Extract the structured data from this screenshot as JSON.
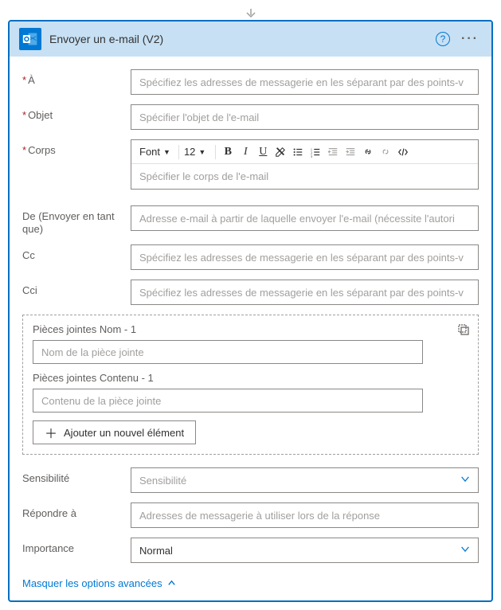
{
  "header": {
    "title": "Envoyer un e-mail (V2)"
  },
  "fields": {
    "to": {
      "label": "À",
      "placeholder": "Spécifiez les adresses de messagerie en les séparant par des points-v"
    },
    "subject": {
      "label": "Objet",
      "placeholder": "Spécifier l'objet de l'e-mail"
    },
    "body": {
      "label": "Corps",
      "placeholder": "Spécifier le corps de l'e-mail",
      "font": "Font",
      "size": "12"
    },
    "from": {
      "label": "De (Envoyer en tant que)",
      "placeholder": "Adresse e-mail à partir de laquelle envoyer l'e-mail (nécessite l'autori"
    },
    "cc": {
      "label": "Cc",
      "placeholder": "Spécifiez les adresses de messagerie en les séparant par des points-v"
    },
    "bcc": {
      "label": "Cci",
      "placeholder": "Spécifiez les adresses de messagerie en les séparant par des points-v"
    },
    "attachments": {
      "nameLabel": "Pièces jointes Nom - 1",
      "namePlaceholder": "Nom de la pièce jointe",
      "contentLabel": "Pièces jointes Contenu - 1",
      "contentPlaceholder": "Contenu de la pièce jointe",
      "addButton": "Ajouter un nouvel élément"
    },
    "sensitivity": {
      "label": "Sensibilité",
      "placeholder": "Sensibilité"
    },
    "replyTo": {
      "label": "Répondre à",
      "placeholder": "Adresses de messagerie à utiliser lors de la réponse"
    },
    "importance": {
      "label": "Importance",
      "value": "Normal"
    }
  },
  "footer": {
    "toggle": "Masquer les options avancées"
  }
}
